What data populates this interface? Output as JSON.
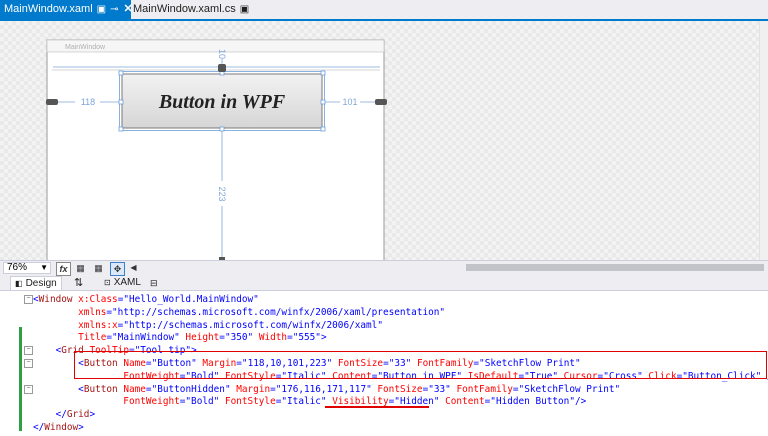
{
  "tabs": [
    {
      "label": "MainWindow.xaml",
      "active": true
    },
    {
      "label": "MainWindow.xaml.cs",
      "active": false
    }
  ],
  "design": {
    "window_caption": "MainWindow",
    "button_text": "Button in WPF",
    "margin_top": "10",
    "margin_left": "118",
    "margin_right": "101",
    "margin_bottom": "223"
  },
  "zoom": {
    "value": "76%",
    "fx_label": "fx"
  },
  "split_tabs": {
    "design": "Design",
    "xaml": "XAML"
  },
  "code_lines": [
    [
      [
        "b",
        "<"
      ],
      [
        "e",
        "Window"
      ],
      [
        "a",
        " x:Class"
      ],
      [
        "b",
        "=\""
      ],
      [
        "v",
        "Hello_World.MainWindow"
      ],
      [
        "b",
        "\""
      ]
    ],
    [
      [
        "a",
        "        xmlns"
      ],
      [
        "b",
        "=\""
      ],
      [
        "v",
        "http://schemas.microsoft.com/winfx/2006/xaml/presentation"
      ],
      [
        "b",
        "\""
      ]
    ],
    [
      [
        "a",
        "        xmlns:x"
      ],
      [
        "b",
        "=\""
      ],
      [
        "v",
        "http://schemas.microsoft.com/winfx/2006/xaml"
      ],
      [
        "b",
        "\""
      ]
    ],
    [
      [
        "a",
        "        Title"
      ],
      [
        "b",
        "=\""
      ],
      [
        "v",
        "MainWindow"
      ],
      [
        "b",
        "\""
      ],
      [
        "a",
        " Height"
      ],
      [
        "b",
        "=\""
      ],
      [
        "v",
        "350"
      ],
      [
        "b",
        "\""
      ],
      [
        "a",
        " Width"
      ],
      [
        "b",
        "=\""
      ],
      [
        "v",
        "555"
      ],
      [
        "b",
        "\">"
      ]
    ],
    [
      [
        "b",
        "    <"
      ],
      [
        "e",
        "Grid"
      ],
      [
        "a",
        " ToolTip"
      ],
      [
        "b",
        "=\""
      ],
      [
        "v",
        "Tool tip"
      ],
      [
        "b",
        "\">"
      ]
    ],
    [
      [
        "b",
        "        <"
      ],
      [
        "e",
        "Button"
      ],
      [
        "a",
        " Name"
      ],
      [
        "b",
        "=\""
      ],
      [
        "v",
        "Button"
      ],
      [
        "b",
        "\""
      ],
      [
        "a",
        " Margin"
      ],
      [
        "b",
        "=\""
      ],
      [
        "v",
        "118,10,101,223"
      ],
      [
        "b",
        "\""
      ],
      [
        "a",
        " FontSize"
      ],
      [
        "b",
        "=\""
      ],
      [
        "v",
        "33"
      ],
      [
        "b",
        "\""
      ],
      [
        "a",
        " FontFamily"
      ],
      [
        "b",
        "=\""
      ],
      [
        "v",
        "SketchFlow Print"
      ],
      [
        "b",
        "\""
      ]
    ],
    [
      [
        "a",
        "                FontWeight"
      ],
      [
        "b",
        "=\""
      ],
      [
        "v",
        "Bold"
      ],
      [
        "b",
        "\""
      ],
      [
        "a",
        " FontStyle"
      ],
      [
        "b",
        "=\""
      ],
      [
        "v",
        "Italic"
      ],
      [
        "b",
        "\""
      ],
      [
        "a",
        " Content"
      ],
      [
        "b",
        "=\""
      ],
      [
        "v",
        "Button in WPF"
      ],
      [
        "b",
        "\""
      ],
      [
        "a",
        " IsDefault"
      ],
      [
        "b",
        "=\""
      ],
      [
        "v",
        "True"
      ],
      [
        "b",
        "\""
      ],
      [
        "a",
        " Cursor"
      ],
      [
        "b",
        "=\""
      ],
      [
        "v",
        "Cross"
      ],
      [
        "b",
        "\""
      ],
      [
        "a",
        " Click"
      ],
      [
        "b",
        "=\""
      ],
      [
        "v",
        "Button_Click"
      ],
      [
        "b",
        "\" />"
      ]
    ],
    [
      [
        "b",
        "        <"
      ],
      [
        "e",
        "Button"
      ],
      [
        "a",
        " Name"
      ],
      [
        "b",
        "=\""
      ],
      [
        "v",
        "ButtonHidden"
      ],
      [
        "b",
        "\""
      ],
      [
        "a",
        " Margin"
      ],
      [
        "b",
        "=\""
      ],
      [
        "v",
        "176,116,171,117"
      ],
      [
        "b",
        "\""
      ],
      [
        "a",
        " FontSize"
      ],
      [
        "b",
        "=\""
      ],
      [
        "v",
        "33"
      ],
      [
        "b",
        "\""
      ],
      [
        "a",
        " FontFamily"
      ],
      [
        "b",
        "=\""
      ],
      [
        "v",
        "SketchFlow Print"
      ],
      [
        "b",
        "\""
      ]
    ],
    [
      [
        "a",
        "                FontWeight"
      ],
      [
        "b",
        "=\""
      ],
      [
        "v",
        "Bold"
      ],
      [
        "b",
        "\""
      ],
      [
        "a",
        " FontStyle"
      ],
      [
        "b",
        "=\""
      ],
      [
        "v",
        "Italic"
      ],
      [
        "b",
        "\""
      ],
      [
        "a",
        " Visibility"
      ],
      [
        "b",
        "=\""
      ],
      [
        "v",
        "Hidden"
      ],
      [
        "b",
        "\""
      ],
      [
        "a",
        " Content"
      ],
      [
        "b",
        "=\""
      ],
      [
        "v",
        "Hidden Button"
      ],
      [
        "b",
        "\"/>"
      ]
    ],
    [
      [
        "b",
        "    </"
      ],
      [
        "e",
        "Grid"
      ],
      [
        "b",
        ">"
      ]
    ],
    [
      [
        "b",
        "</"
      ],
      [
        "e",
        "Window"
      ],
      [
        "b",
        ">"
      ]
    ]
  ]
}
